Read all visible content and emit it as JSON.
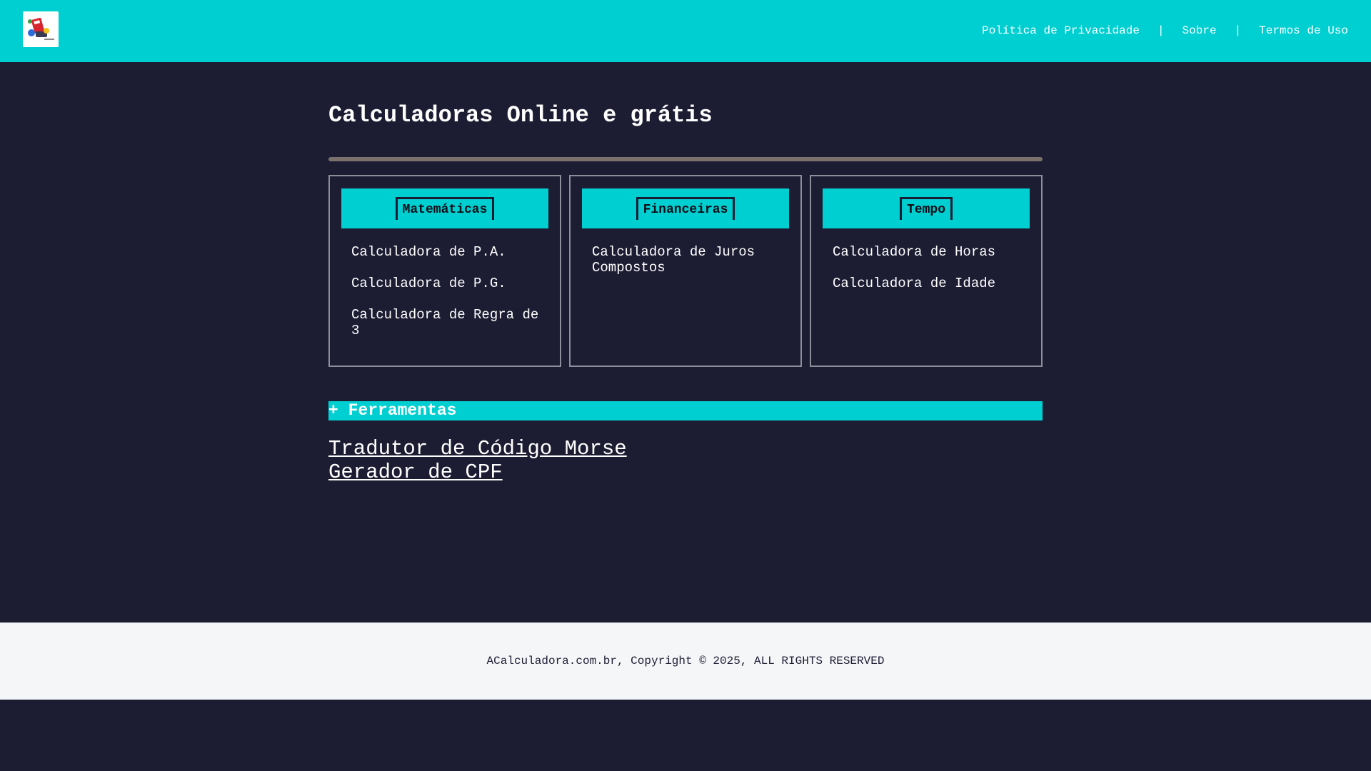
{
  "header": {
    "logo_icon": "calculator-logo-icon",
    "nav": {
      "privacy": "Política de Privacidade",
      "separator": "|",
      "about": "Sobre",
      "terms": "Termos de Uso"
    }
  },
  "main": {
    "title": "Calculadoras Online e grátis",
    "categories": [
      {
        "title": "Matemáticas",
        "items": [
          "Calculadora de P.A.",
          "Calculadora de P.G.",
          "Calculadora de Regra de 3"
        ]
      },
      {
        "title": "Financeiras",
        "items": [
          "Calculadora de Juros Compostos"
        ]
      },
      {
        "title": "Tempo",
        "items": [
          "Calculadora de Horas",
          "Calculadora de Idade"
        ]
      }
    ],
    "tools": {
      "heading": "+ Ferramentas",
      "links": [
        "Tradutor de Código Morse",
        "Gerador de CPF"
      ]
    }
  },
  "footer": {
    "copyright": "ACalculadora.com.br, Copyright © 2025, ALL RIGHTS RESERVED"
  },
  "colors": {
    "accent": "#00cfd1",
    "background": "#1c1d33",
    "footer_bg": "#f5f6f8"
  }
}
